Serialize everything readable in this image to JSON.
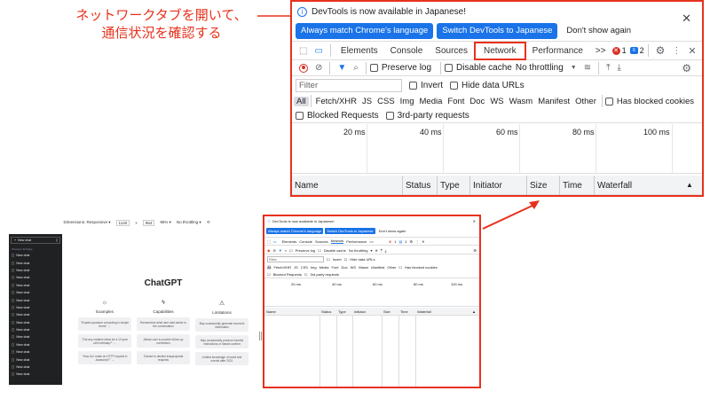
{
  "annotation": {
    "line1": "ネットワークタブを開いて、",
    "line2": "通信状況を確認する"
  },
  "devtools": {
    "info_message": "DevTools is now available in Japanese!",
    "buttons": {
      "always_match": "Always match Chrome's language",
      "switch": "Switch DevTools to Japanese",
      "dont_show": "Don't show again"
    },
    "tabs": [
      "Elements",
      "Console",
      "Sources",
      "Network",
      "Performance"
    ],
    "active_tab": "Network",
    "more_tabs": ">>",
    "error_count": "1",
    "message_count": "2",
    "toolbar": {
      "preserve_log": "Preserve log",
      "disable_cache": "Disable cache",
      "throttling": "No throttling"
    },
    "filter": {
      "placeholder": "Filter",
      "invert": "Invert",
      "hide_data_urls": "Hide data URLs"
    },
    "types": [
      "All",
      "Fetch/XHR",
      "JS",
      "CSS",
      "Img",
      "Media",
      "Font",
      "Doc",
      "WS",
      "Wasm",
      "Manifest",
      "Other"
    ],
    "has_blocked_cookies": "Has blocked cookies",
    "blocked_requests": "Blocked Requests",
    "third_party": "3rd-party requests",
    "timeline_ticks": [
      "20 ms",
      "40 ms",
      "60 ms",
      "80 ms",
      "100 ms"
    ],
    "columns": [
      "Name",
      "Status",
      "Type",
      "Initiator",
      "Size",
      "Time",
      "Waterfall"
    ]
  },
  "browser": {
    "device_toolbar": {
      "dimensions_label": "Dimensions: Responsive ▾",
      "width": "1140",
      "times": "×",
      "height": "964",
      "zoom": "95% ▾",
      "throttle": "No throttling ▾"
    },
    "sidebar": {
      "new_chat": "New chat",
      "section": "Previous 30 Days",
      "items": [
        "New chat",
        "New chat",
        "New chat",
        "New chat",
        "New chat",
        "New chat",
        "New chat",
        "New chat",
        "New chat",
        "New chat",
        "New chat",
        "New chat",
        "New chat",
        "New chat",
        "New chat",
        "New chat",
        "New chat"
      ]
    },
    "main": {
      "title": "ChatGPT",
      "columns": [
        {
          "icon": "sun-icon",
          "glyph": "☼",
          "heading": "Examples",
          "cards": [
            "\"Explain quantum computing in simple terms\" →",
            "\"Got any creative ideas for a 10 year old's birthday?\" →",
            "\"How do I make an HTTP request in Javascript?\" →"
          ]
        },
        {
          "icon": "lightning-icon",
          "glyph": "ϟ",
          "heading": "Capabilities",
          "cards": [
            "Remembers what user said earlier in the conversation",
            "Allows user to provide follow-up corrections",
            "Trained to decline inappropriate requests"
          ]
        },
        {
          "icon": "warning-icon",
          "glyph": "⚠",
          "heading": "Limitations",
          "cards": [
            "May occasionally generate incorrect information",
            "May occasionally produce harmful instructions or biased content",
            "Limited knowledge of world and events after 2021"
          ]
        }
      ]
    }
  },
  "colors": {
    "highlight": "#e8311d",
    "accent": "#1a73e8",
    "sidebar_bg": "#202123"
  }
}
